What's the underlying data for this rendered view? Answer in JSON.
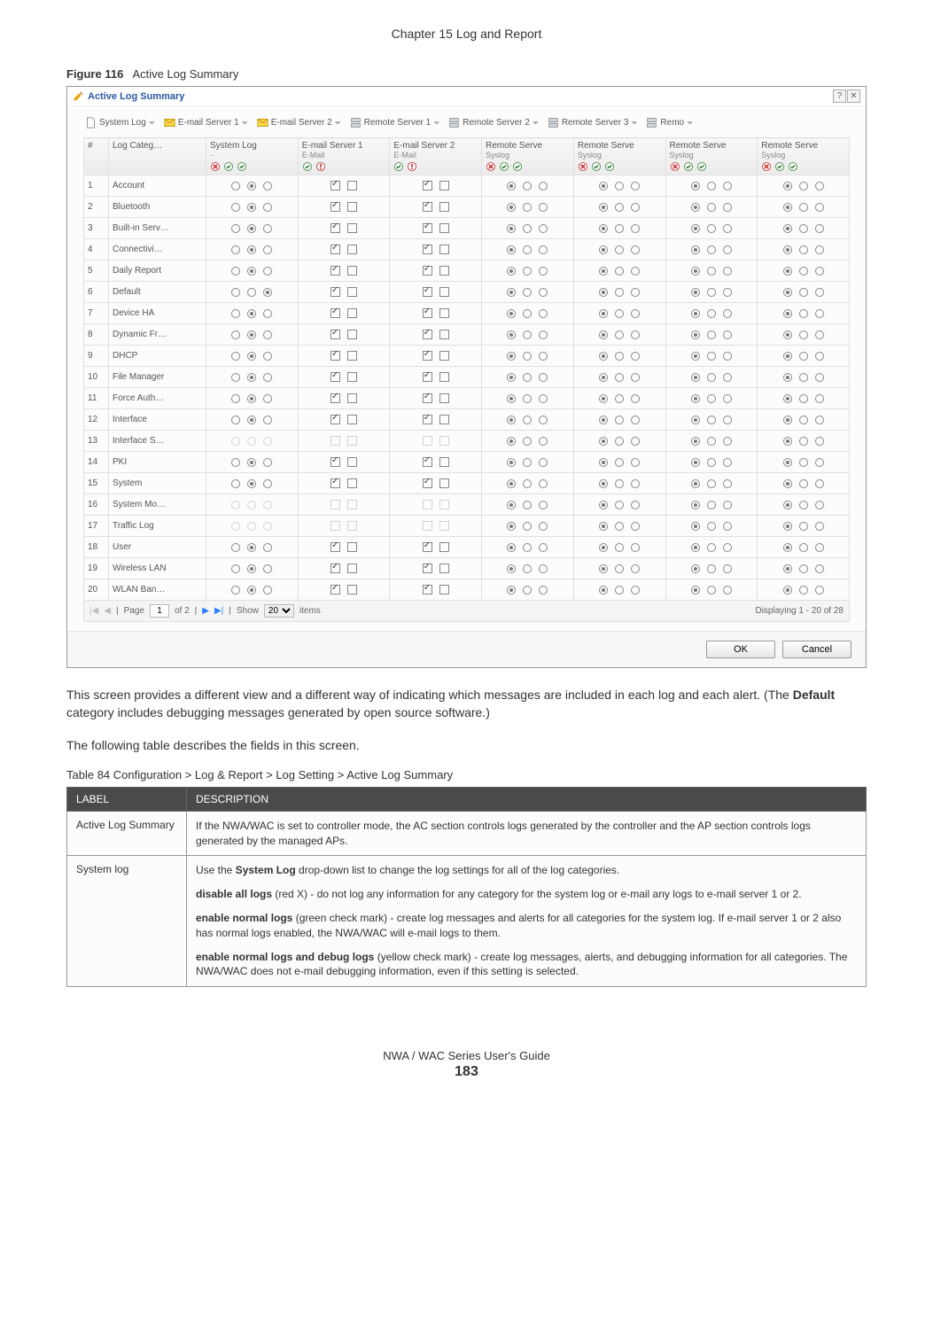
{
  "page": {
    "chapter": "Chapter 15 Log and Report",
    "footer": "NWA / WAC Series User's Guide",
    "page_number": "183"
  },
  "figure": {
    "number": "Figure 116",
    "title": "Active Log Summary"
  },
  "dialog": {
    "title": "Active Log Summary",
    "menubar": [
      {
        "label": "System Log",
        "icon": "doc"
      },
      {
        "label": "E-mail Server 1",
        "icon": "mail"
      },
      {
        "label": "E-mail Server 2",
        "icon": "mail"
      },
      {
        "label": "Remote Server 1",
        "icon": "server"
      },
      {
        "label": "Remote Server 2",
        "icon": "server"
      },
      {
        "label": "Remote Server 3",
        "icon": "server"
      },
      {
        "label": "Remo",
        "icon": "server"
      }
    ],
    "columns": [
      {
        "h": "#",
        "sub": ""
      },
      {
        "h": "Log Categ…",
        "sub": ""
      },
      {
        "h": "System Log",
        "sub": "-",
        "icons": [
          "x",
          "ok",
          "ok"
        ]
      },
      {
        "h": "E-mail Server 1",
        "sub": "E-Mail",
        "icons": [
          "ok",
          "warn"
        ]
      },
      {
        "h": "E-mail Server 2",
        "sub": "E-Mail",
        "icons": [
          "ok",
          "warn"
        ]
      },
      {
        "h": "Remote Serve",
        "sub": "Syslog",
        "icons": [
          "x",
          "ok",
          "ok"
        ]
      },
      {
        "h": "Remote Serve",
        "sub": "Syslog",
        "icons": [
          "x",
          "ok",
          "ok"
        ]
      },
      {
        "h": "Remote Serve",
        "sub": "Syslog",
        "icons": [
          "x",
          "ok",
          "ok"
        ]
      },
      {
        "h": "Remote Serve",
        "sub": "Syslog",
        "icons": [
          "x",
          "ok",
          "ok"
        ]
      }
    ],
    "rows": [
      {
        "n": "1",
        "name": "Account",
        "sys": [
          0,
          1,
          0
        ],
        "e1": [
          1,
          0
        ],
        "e2": [
          1,
          0
        ]
      },
      {
        "n": "2",
        "name": "Bluetooth",
        "sys": [
          0,
          1,
          0
        ],
        "e1": [
          1,
          0
        ],
        "e2": [
          1,
          0
        ]
      },
      {
        "n": "3",
        "name": "Built-in Serv…",
        "sys": [
          0,
          1,
          0
        ],
        "e1": [
          1,
          0
        ],
        "e2": [
          1,
          0
        ]
      },
      {
        "n": "4",
        "name": "Connectivi…",
        "sys": [
          0,
          1,
          0
        ],
        "e1": [
          1,
          0
        ],
        "e2": [
          1,
          0
        ]
      },
      {
        "n": "5",
        "name": "Daily Report",
        "sys": [
          0,
          1,
          0
        ],
        "e1": [
          1,
          0
        ],
        "e2": [
          1,
          0
        ]
      },
      {
        "n": "6",
        "name": "Default",
        "sys": [
          0,
          0,
          1
        ],
        "e1": [
          1,
          0
        ],
        "e2": [
          1,
          0
        ]
      },
      {
        "n": "7",
        "name": "Device HA",
        "sys": [
          0,
          1,
          0
        ],
        "e1": [
          1,
          0
        ],
        "e2": [
          1,
          0
        ]
      },
      {
        "n": "8",
        "name": "Dynamic Fr…",
        "sys": [
          0,
          1,
          0
        ],
        "e1": [
          1,
          0
        ],
        "e2": [
          1,
          0
        ]
      },
      {
        "n": "9",
        "name": "DHCP",
        "sys": [
          0,
          1,
          0
        ],
        "e1": [
          1,
          0
        ],
        "e2": [
          1,
          0
        ]
      },
      {
        "n": "10",
        "name": "File Manager",
        "sys": [
          0,
          1,
          0
        ],
        "e1": [
          1,
          0
        ],
        "e2": [
          1,
          0
        ]
      },
      {
        "n": "11",
        "name": "Force Auth…",
        "sys": [
          0,
          1,
          0
        ],
        "e1": [
          1,
          0
        ],
        "e2": [
          1,
          0
        ]
      },
      {
        "n": "12",
        "name": "Interface",
        "sys": [
          0,
          1,
          0
        ],
        "e1": [
          1,
          0
        ],
        "e2": [
          1,
          0
        ]
      },
      {
        "n": "13",
        "name": "Interface S…",
        "sys": [
          0,
          0,
          0
        ],
        "dim": true,
        "e1": [
          0,
          0
        ],
        "e2": [
          0,
          0
        ]
      },
      {
        "n": "14",
        "name": "PKI",
        "sys": [
          0,
          1,
          0
        ],
        "e1": [
          1,
          0
        ],
        "e2": [
          1,
          0
        ]
      },
      {
        "n": "15",
        "name": "System",
        "sys": [
          0,
          1,
          0
        ],
        "e1": [
          1,
          0
        ],
        "e2": [
          1,
          0
        ]
      },
      {
        "n": "16",
        "name": "System Mo…",
        "sys": [
          0,
          0,
          0
        ],
        "dim": true,
        "e1": [
          0,
          0
        ],
        "e2": [
          0,
          0
        ]
      },
      {
        "n": "17",
        "name": "Traffic Log",
        "sys": [
          0,
          0,
          0
        ],
        "dim": true,
        "e1": [
          0,
          0
        ],
        "e2": [
          0,
          0
        ]
      },
      {
        "n": "18",
        "name": "User",
        "sys": [
          0,
          1,
          0
        ],
        "e1": [
          1,
          0
        ],
        "e2": [
          1,
          0
        ]
      },
      {
        "n": "19",
        "name": "Wireless LAN",
        "sys": [
          0,
          1,
          0
        ],
        "e1": [
          1,
          0
        ],
        "e2": [
          1,
          0
        ]
      },
      {
        "n": "20",
        "name": "WLAN Ban…",
        "sys": [
          0,
          1,
          0
        ],
        "e1": [
          1,
          0
        ],
        "e2": [
          1,
          0
        ]
      }
    ],
    "pager": {
      "page_label": "Page",
      "page_value": "1",
      "of_label": "of 2",
      "show_label": "Show",
      "per_page": "20",
      "items_label": "items",
      "status": "Displaying 1 - 20 of 28"
    },
    "buttons": {
      "ok": "OK",
      "cancel": "Cancel"
    }
  },
  "body_para": "This screen provides a different view and a different way of indicating which messages are included in each log and each alert. (The ",
  "body_para_bold": "Default",
  "body_para_after": " category includes debugging messages generated by open source software.)",
  "body_para2": "The following table describes the fields in this screen.",
  "table_caption": "Table 84   Configuration > Log & Report > Log Setting > Active Log Summary",
  "table": {
    "head": {
      "c1": "LABEL",
      "c2": "DESCRIPTION"
    },
    "rows": [
      {
        "label": "Active Log Summary",
        "paras": [
          "If the NWA/WAC is set to controller mode, the AC section controls logs generated by the controller and the AP section controls logs generated by the managed APs."
        ]
      },
      {
        "label": "System log",
        "paras": [
          {
            "pre": "Use the ",
            "b": "System Log",
            "post": " drop-down list to change the log settings for all of the log categories."
          },
          {
            "b": "disable all logs",
            "post": " (red X) - do not log any information for any category for the system log or e-mail any logs to e-mail server 1 or 2."
          },
          {
            "b": "enable normal logs",
            "post": " (green check mark) - create log messages and alerts for all categories for the system log. If e-mail server 1 or 2 also has normal logs enabled, the NWA/WAC will e-mail logs to them."
          },
          {
            "b": "enable normal logs and debug logs",
            "post": " (yellow check mark) - create log messages, alerts, and debugging information for all categories. The NWA/WAC does not e-mail debugging information, even if this setting is selected."
          }
        ]
      }
    ]
  }
}
